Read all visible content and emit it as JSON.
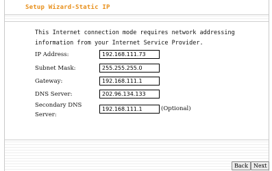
{
  "page": {
    "title": "Setup Wizard-Static IP",
    "intro": "This Internet connection mode requires network addressing information from your Internet Service Provider."
  },
  "fields": {
    "ip_address": {
      "label": "IP Address:",
      "value": "192.168.111.73"
    },
    "subnet_mask": {
      "label": "Subnet Mask:",
      "value": "255.255.255.0"
    },
    "gateway": {
      "label": "Gateway:",
      "value": "192.168.111.1"
    },
    "dns_server": {
      "label": "DNS Server:",
      "value": "202.96.134.133"
    },
    "secondary_dns": {
      "label_line1": "Secondary DNS",
      "label_line2": "Server:",
      "value": "192.168.111.1",
      "note": "(Optional)"
    }
  },
  "buttons": {
    "back": "Back",
    "next": "Next"
  },
  "colors": {
    "title": "#e8901c",
    "stripe": "#eeeeee"
  }
}
